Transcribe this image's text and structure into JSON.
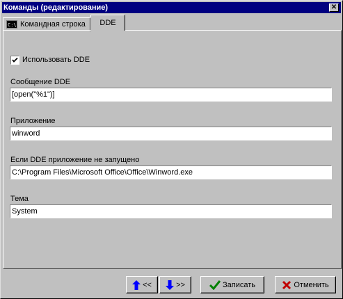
{
  "window": {
    "title": "Команды (редактирование)",
    "close_label": "✕"
  },
  "tabs": [
    {
      "label": "Командная строка",
      "icon_text": "C:\\"
    },
    {
      "label": "DDE"
    }
  ],
  "dde": {
    "use_dde_label": "Использовать DDE",
    "use_dde_checked": true,
    "fields": [
      {
        "label": "Сообщение DDE",
        "value": "[open(\"%1\")]"
      },
      {
        "label": "Приложение",
        "value": "winword"
      },
      {
        "label": "Если DDE приложение не запущено",
        "value": "C:\\Program Files\\Microsoft Office\\Office\\Winword.exe"
      },
      {
        "label": "Тема",
        "value": "System"
      }
    ]
  },
  "buttons": {
    "prev_label": "<<",
    "next_label": ">>",
    "save_label": "Записать",
    "cancel_label": "Отменить"
  },
  "colors": {
    "titlebar": "#000080",
    "face": "#c0c0c0",
    "arrow_blue": "#0000ff",
    "check_green": "#008000",
    "cross_red": "#c00000"
  }
}
